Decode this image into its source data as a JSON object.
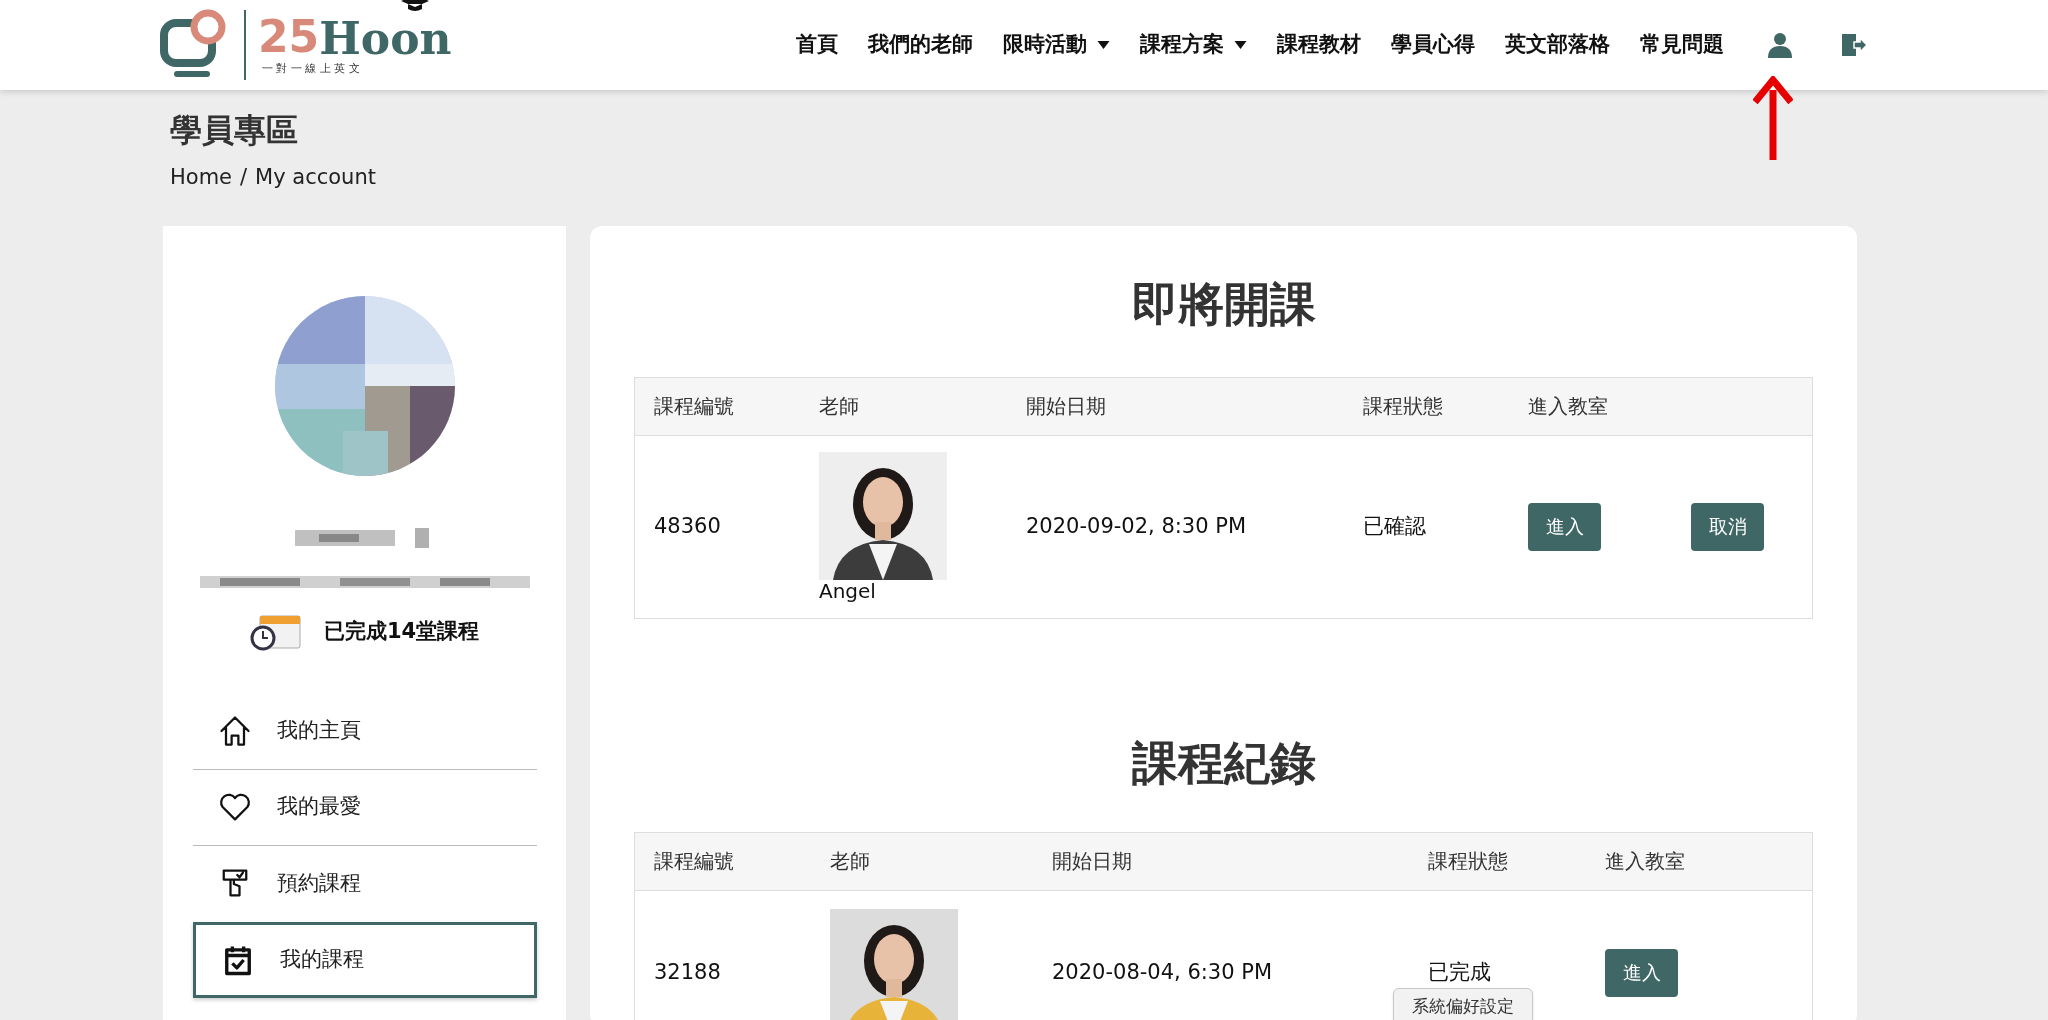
{
  "header": {
    "logo": {
      "number": "25",
      "word": "Hoon",
      "tagline": "一 對 一 線 上 英 文"
    },
    "nav": [
      {
        "label": "首頁",
        "dropdown": false
      },
      {
        "label": "我們的老師",
        "dropdown": false
      },
      {
        "label": "限時活動",
        "dropdown": true
      },
      {
        "label": "課程方案",
        "dropdown": true
      },
      {
        "label": "課程教材",
        "dropdown": false
      },
      {
        "label": "學員心得",
        "dropdown": false
      },
      {
        "label": "英文部落格",
        "dropdown": false
      },
      {
        "label": "常見問題",
        "dropdown": false
      }
    ]
  },
  "page": {
    "title": "學員專區",
    "breadcrumb": {
      "home": "Home",
      "separator": "/",
      "current": "My account"
    }
  },
  "profile": {
    "completed": "已完成14堂課程",
    "menu": [
      {
        "label": "我的主頁",
        "kind": "home",
        "selected": false
      },
      {
        "label": "我的最愛",
        "kind": "heart",
        "selected": false
      },
      {
        "label": "預約課程",
        "kind": "booking",
        "selected": false
      },
      {
        "label": "我的課程",
        "kind": "calendar",
        "selected": true
      }
    ]
  },
  "upcoming": {
    "title": "即將開課",
    "columns": [
      "課程編號",
      "老師",
      "開始日期",
      "課程狀態",
      "進入教室"
    ],
    "rows": [
      {
        "id": "48360",
        "teacher": "Angel",
        "date": "2020-09-02, 8:30 PM",
        "status": "已確認",
        "actions": [
          "進入",
          "取消"
        ]
      }
    ]
  },
  "history": {
    "title": "課程紀錄",
    "columns": [
      "課程編號",
      "老師",
      "開始日期",
      "課程狀態",
      "進入教室"
    ],
    "rows": [
      {
        "id": "32188",
        "date": "2020-08-04, 6:30 PM",
        "status": "已完成",
        "actions": [
          "進入"
        ]
      }
    ]
  },
  "tooltip": "系統偏好設定"
}
